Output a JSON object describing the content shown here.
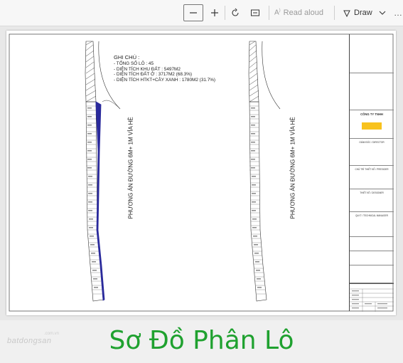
{
  "toolbar": {
    "read_aloud_label": "Read aloud",
    "draw_label": "Draw",
    "more_label": "…"
  },
  "notes": {
    "title": "GHI CHÚ :",
    "lines": [
      "- TỔNG SỐ LÔ : 45",
      "- DIỆN TÍCH KHU ĐẤT : 5497M2",
      "- DIỆN TÍCH ĐẤT Ở : 3717M2 (68.3%)",
      "- DIỆN TÍCH HTKT+CÂY XANH : 1780M2 (31.7%)"
    ]
  },
  "road_label_left": "PHƯƠNG ÁN ĐƯỜNG 6M+ 1M VỈA HÈ",
  "road_label_right": "PHƯƠNG ÁN ĐƯỜNG 6M+ 1M VỈA HÈ",
  "title_block": {
    "company": "CÔNG TY TNHH",
    "director": "GIÁM ĐỐC / DIRECTOR",
    "chief_designer": "CHỦ TRÌ THIẾT KẾ / PRESIGER",
    "designer": "THIẾT KẾ / DESIGNER",
    "technical_manager": "QLKT / TECHNICAL MANAGER"
  },
  "watermark": {
    "brand": "batdongsan",
    "domain": ".com.vn"
  },
  "banner": {
    "title": "Sơ Đồ Phân Lô"
  },
  "colors": {
    "banner_title": "#1fa12f",
    "highlight": "#f8c21d",
    "plot_outline": "#2a2a9c"
  }
}
